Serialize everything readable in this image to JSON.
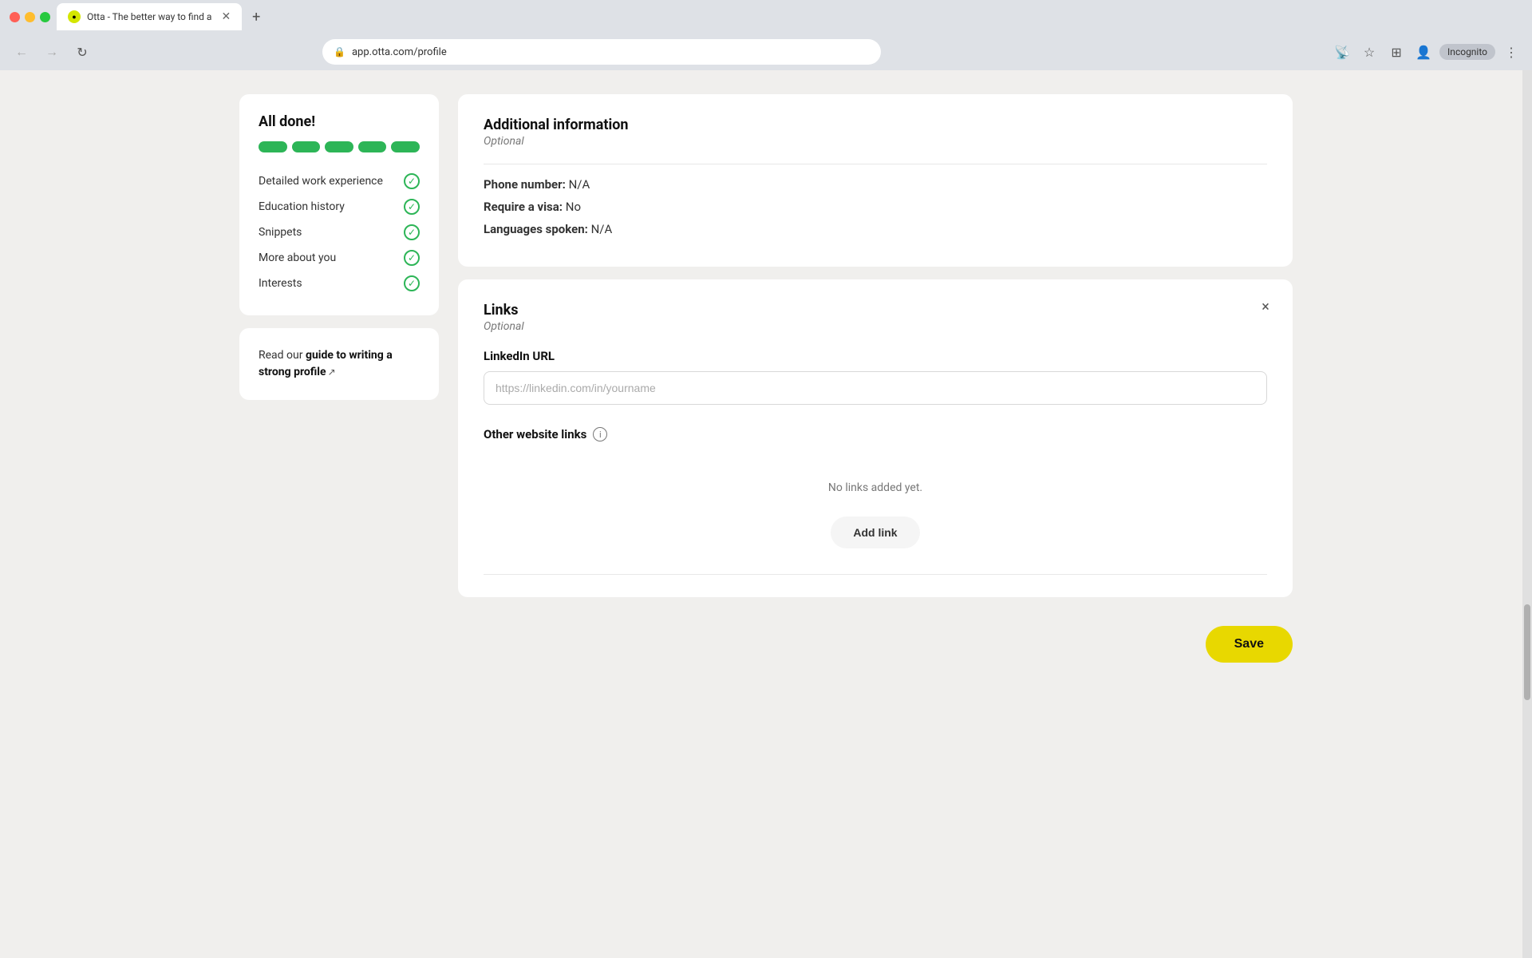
{
  "browser": {
    "tab_title": "Otta - The better way to find a",
    "tab_favicon": "●",
    "address": "app.otta.com/profile",
    "incognito_label": "Incognito",
    "new_tab_symbol": "+"
  },
  "sidebar": {
    "completion_title": "All done!",
    "progress_dots": [
      1,
      2,
      3,
      4,
      5
    ],
    "checklist": [
      {
        "label": "Detailed work experience",
        "done": true
      },
      {
        "label": "Education history",
        "done": true
      },
      {
        "label": "Snippets",
        "done": true
      },
      {
        "label": "More about you",
        "done": true
      },
      {
        "label": "Interests",
        "done": true
      }
    ],
    "guide_text_prefix": "Read our ",
    "guide_link": "guide to writing a strong profile",
    "guide_suffix": ""
  },
  "additional_info": {
    "section_title": "Additional information",
    "section_subtitle": "Optional",
    "phone_label": "Phone number:",
    "phone_value": "N/A",
    "visa_label": "Require a visa:",
    "visa_value": "No",
    "languages_label": "Languages spoken:",
    "languages_value": "N/A"
  },
  "links": {
    "section_title": "Links",
    "section_subtitle": "Optional",
    "linkedin_label": "LinkedIn URL",
    "linkedin_placeholder": "https://linkedin.com/in/yourname",
    "other_links_title": "Other website links",
    "no_links_text": "No links added yet.",
    "add_link_btn": "Add link",
    "close_symbol": "×"
  },
  "footer": {
    "save_btn": "Save"
  }
}
